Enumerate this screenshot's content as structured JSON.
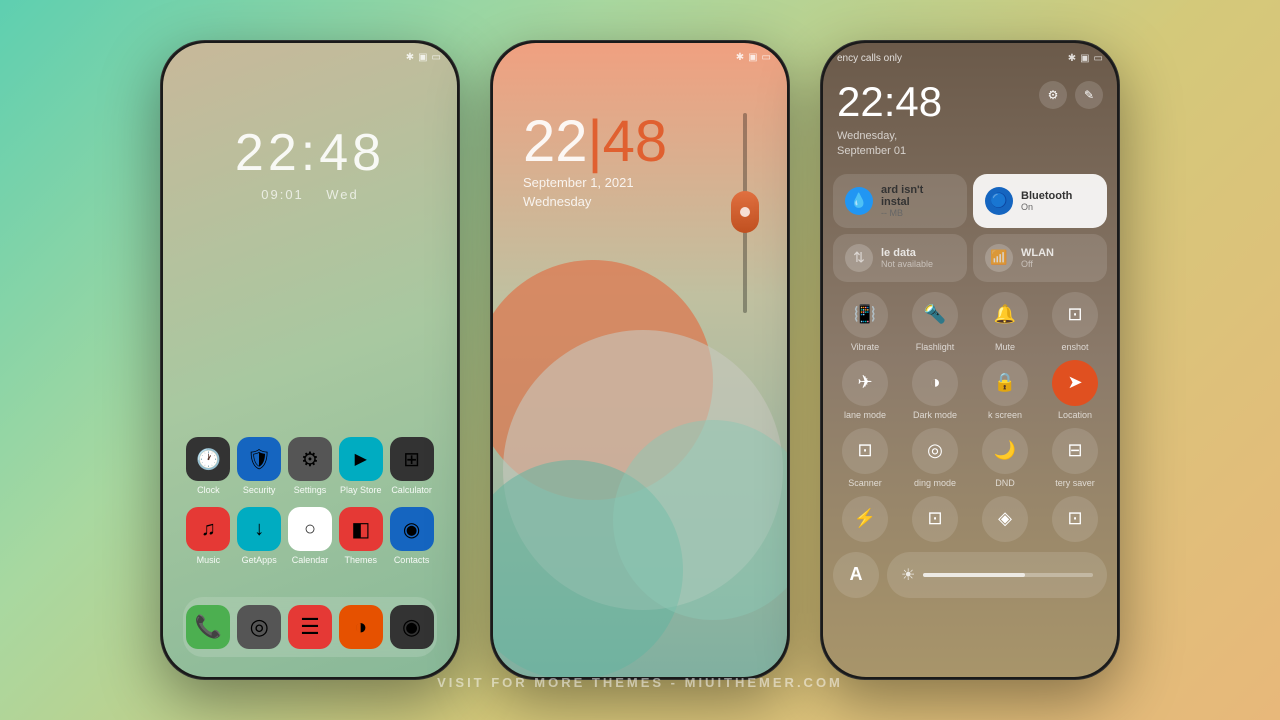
{
  "background": {
    "gradient": "linear-gradient(135deg, #5ecfb0 0%, #a8d8a0 30%, #d4c97a 60%, #e8b87a 100%)"
  },
  "watermark": {
    "text": "VISIT FOR MORE THEMES - MIUITHEMER.COM"
  },
  "phone1": {
    "statusbar": {
      "bluetooth": "✱",
      "signal": "▣",
      "battery": "▭"
    },
    "time": "22:48",
    "subtime": "09:01",
    "day": "Wed",
    "apps": [
      {
        "label": "Clock",
        "icon": "🕐",
        "bg": "#333"
      },
      {
        "label": "Security",
        "icon": "🛡",
        "bg": "#2196f3"
      },
      {
        "label": "Settings",
        "icon": "⚙",
        "bg": "#555"
      },
      {
        "label": "Play Store",
        "icon": "▶",
        "bg": "#00bcd4"
      },
      {
        "label": "Calculator",
        "icon": "⊞",
        "bg": "#333"
      }
    ],
    "apps2": [
      {
        "label": "Music",
        "icon": "♫",
        "bg": "#e53935"
      },
      {
        "label": "GetApps",
        "icon": "↓",
        "bg": "#00acc1"
      },
      {
        "label": "Calendar",
        "icon": "○",
        "bg": "#fff"
      },
      {
        "label": "Themes",
        "icon": "◧",
        "bg": "#e53935"
      },
      {
        "label": "Contacts",
        "icon": "◉",
        "bg": "#1565c0"
      }
    ],
    "dock": [
      {
        "icon": "📞",
        "bg": "#4caf50"
      },
      {
        "icon": "◎",
        "bg": "#555"
      },
      {
        "icon": "≡",
        "bg": "#e53935"
      },
      {
        "icon": "◑",
        "bg": "#e65100"
      },
      {
        "icon": "◉",
        "bg": "#333"
      }
    ]
  },
  "phone2": {
    "time_h": "22",
    "time_m": "48",
    "date_line1": "September 1, 2021",
    "date_line2": "Wednesday"
  },
  "phone3": {
    "status_left": "ency calls only",
    "time": "22:48",
    "date_line1": "Wednesday,",
    "date_line2": "September 01",
    "card1": {
      "title": "ard isn't instal",
      "sub": "-- MB"
    },
    "bluetooth": {
      "title": "Bluetooth",
      "sub": "On"
    },
    "mobile_data": {
      "title": "le data",
      "sub": "Not available"
    },
    "wlan": {
      "title": "WLAN",
      "sub": "Off"
    },
    "controls": [
      {
        "icon": "📳",
        "label": "Vibrate"
      },
      {
        "icon": "🔦",
        "label": "Flashlight"
      },
      {
        "icon": "🔔",
        "label": "Mute"
      },
      {
        "icon": "⊡",
        "label": "enshot"
      }
    ],
    "controls2": [
      {
        "icon": "✈",
        "label": "lane mode"
      },
      {
        "icon": "◑",
        "label": "Dark mode"
      },
      {
        "icon": "🔒",
        "label": "k screen"
      },
      {
        "icon": "➤",
        "label": "Location",
        "active": true
      }
    ],
    "controls3": [
      {
        "icon": "⊡",
        "label": "Scanner"
      },
      {
        "icon": "◎",
        "label": "ding mode"
      },
      {
        "icon": "🌙",
        "label": "DND"
      },
      {
        "icon": "⊟",
        "label": "tery saver"
      }
    ],
    "controls4": [
      {
        "icon": "⚡",
        "label": ""
      },
      {
        "icon": "⊡",
        "label": ""
      },
      {
        "icon": "◈",
        "label": ""
      },
      {
        "icon": "⊡",
        "label": ""
      }
    ],
    "bottom_text_btn": "A",
    "brightness_icon": "☀"
  }
}
